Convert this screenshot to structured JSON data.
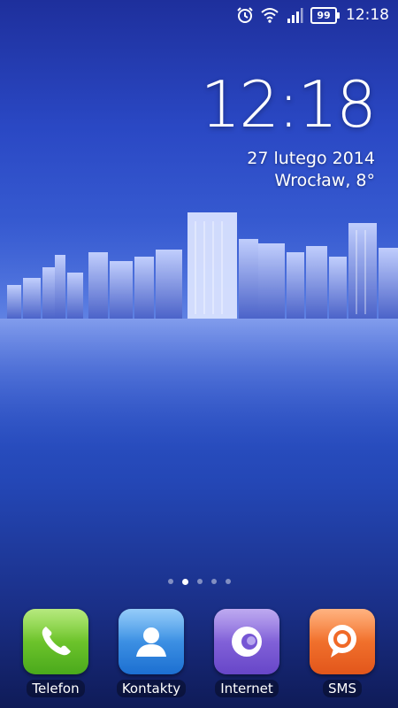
{
  "status_bar": {
    "battery_level": "99",
    "time": "12:18",
    "icons": [
      "alarm-icon",
      "wifi-icon",
      "signal-icon",
      "battery-icon"
    ]
  },
  "clock_widget": {
    "time": "12:18",
    "date": "27 lutego 2014",
    "weather": "Wrocław, 8°"
  },
  "page_indicator": {
    "pages": 5,
    "active": 2
  },
  "dock": {
    "apps": [
      {
        "label": "Telefon",
        "icon": "phone-icon",
        "color": "#5fb92a"
      },
      {
        "label": "Kontakty",
        "icon": "contacts-icon",
        "color": "#2a82e0"
      },
      {
        "label": "Internet",
        "icon": "browser-icon",
        "color": "#7a5ad8"
      },
      {
        "label": "SMS",
        "icon": "sms-icon",
        "color": "#f06a28"
      }
    ]
  }
}
